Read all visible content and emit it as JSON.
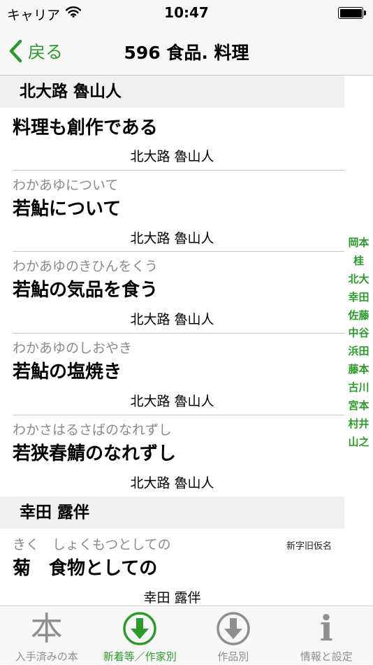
{
  "status_bar": {
    "carrier": "キャリア",
    "time": "10:47",
    "wifi_icon": "wifi-icon",
    "battery_icon": "battery-icon"
  },
  "nav": {
    "back_label": "戻る",
    "back_icon": "chevron-left-icon",
    "title": "596 食品. 料理"
  },
  "sections": [
    {
      "header": "北大路 魯山人",
      "rows": [
        {
          "reading": "",
          "title": "料理も創作である",
          "author": "北大路 魯山人"
        },
        {
          "reading": "わかあゆについて",
          "title": "若鮎について",
          "author": "北大路 魯山人"
        },
        {
          "reading": "わかあゆのきひんをくう",
          "title": "若鮎の気品を食う",
          "author": "北大路 魯山人"
        },
        {
          "reading": "わかあゆのしおやき",
          "title": "若鮎の塩焼き",
          "author": "北大路 魯山人"
        },
        {
          "reading": "わかさはるさばのなれずし",
          "title": "若狭春鯖のなれずし",
          "author": "北大路 魯山人"
        }
      ]
    },
    {
      "header": "幸田 露伴",
      "rows": [
        {
          "reading": "きく　しょくもつとしての",
          "title": "菊　食物としての",
          "author": "幸田 露伴",
          "badge": "新字旧仮名"
        }
      ]
    }
  ],
  "index": [
    "岡本",
    "桂",
    "北大",
    "幸田",
    "佐藤",
    "中谷",
    "浜田",
    "藤本",
    "古川",
    "宮本",
    "村井",
    "山之"
  ],
  "tabs": [
    {
      "label": "入手済みの本",
      "icon": "book-icon",
      "active": false
    },
    {
      "label": "新着等／作家別",
      "icon": "download-circle-icon",
      "active": true
    },
    {
      "label": "作品別",
      "icon": "download-circle-icon",
      "active": false
    },
    {
      "label": "情報と設定",
      "icon": "info-icon",
      "active": false
    }
  ],
  "icon_glyphs": {
    "book": "本",
    "info": "i"
  },
  "colors": {
    "accent": "#2e9a2e",
    "inactive": "#8e8e93",
    "section_bg": "#f0f0f0",
    "bar_bg": "#f7f7f7"
  }
}
